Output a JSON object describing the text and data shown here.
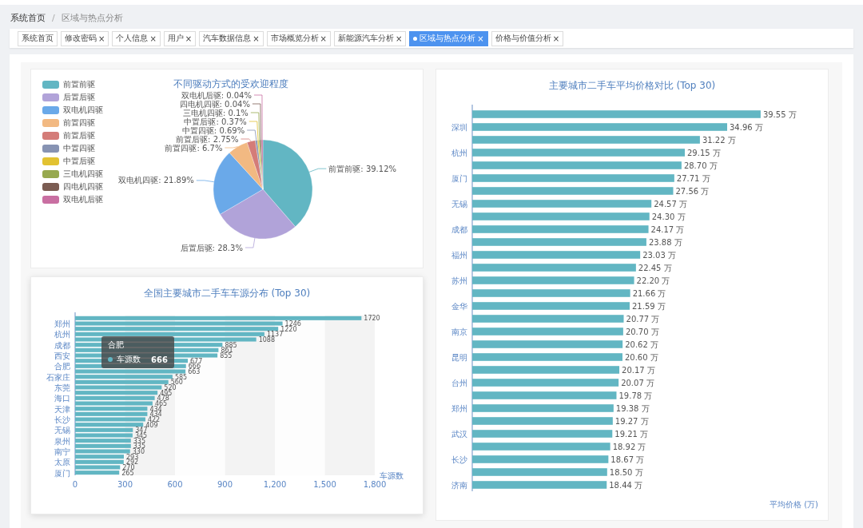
{
  "breadcrumb": {
    "items": [
      "系统首页",
      "区域与热点分析"
    ],
    "separator": "/"
  },
  "tabs": [
    {
      "label": "系统首页",
      "selected": false
    },
    {
      "label": "修改密码",
      "close": "×",
      "selected": false
    },
    {
      "label": "个人信息",
      "close": "×",
      "selected": false
    },
    {
      "label": "用户",
      "close": "×",
      "selected": false
    },
    {
      "label": "汽车数据信息",
      "close": "×",
      "selected": false
    },
    {
      "label": "市场概览分析",
      "close": "×",
      "selected": false
    },
    {
      "label": "新能源汽车分析",
      "close": "×",
      "selected": false
    },
    {
      "label": "区域与热点分析",
      "close": "×",
      "selected": true
    },
    {
      "label": "价格与价值分析",
      "close": "×",
      "selected": false
    }
  ],
  "drive_card": {
    "chart_data": {
      "type": "pie",
      "title": "不同驱动方式的受欢迎程度",
      "categories": [
        "前置前驱",
        "后置后驱",
        "双电机四驱",
        "前置四驱",
        "前置后驱",
        "中置四驱",
        "中置后驱",
        "三电机四驱",
        "四电机四驱",
        "双电机后驱"
      ],
      "values": [
        39.12,
        28.3,
        21.89,
        6.7,
        2.75,
        0.69,
        0.37,
        0.1,
        0.04,
        0.04
      ],
      "colors": [
        "#62b6c3",
        "#b1a3d9",
        "#6aa9e9",
        "#f2b982",
        "#d47c78",
        "#8793b3",
        "#e2c232",
        "#97a94f",
        "#7b5c52",
        "#c96fa2"
      ],
      "value_labels": [
        "前置前驱: 39.12%",
        "后置后驱: 28.3%",
        "双电机四驱: 21.89%",
        "前置四驱: 6.7%",
        "前置后驱: 2.75%",
        "中置四驱: 0.69%",
        "中置后驱: 0.37%",
        "三电机四驱: 0.1%",
        "四电机四驱: 0.04%",
        "双电机后驱: 0.04%"
      ]
    }
  },
  "city_card": {
    "chart_data": {
      "type": "bar",
      "orientation": "horizontal",
      "title": "全国主要城市二手车车源分布 (Top 30)",
      "xlabel": "车源数",
      "categories": [
        null,
        "郑州",
        null,
        "杭州",
        null,
        "成都",
        null,
        "西安",
        null,
        "合肥",
        null,
        "石家庄",
        null,
        "东莞",
        null,
        "海口",
        null,
        "天津",
        null,
        "长沙",
        null,
        "无锡",
        null,
        "泉州",
        null,
        "南宁",
        null,
        "太原",
        null,
        "厦门"
      ],
      "series": [
        {
          "name": "车源数",
          "color": "#62b6c3",
          "values": [
            1720,
            1246,
            1220,
            1137,
            1088,
            885,
            861,
            855,
            677,
            666,
            663,
            585,
            560,
            520,
            495,
            478,
            465,
            434,
            434,
            422,
            409,
            347,
            345,
            335,
            335,
            330,
            293,
            292,
            270,
            265
          ]
        }
      ],
      "xlim": [
        0,
        1800
      ],
      "xticks": [
        0,
        300,
        600,
        900,
        {
          "value": 1200,
          "label": "1,200"
        },
        {
          "value": 1500,
          "label": "1,500"
        },
        {
          "value": 1800,
          "label": "1,800"
        }
      ],
      "data_labels": true
    },
    "tooltip": {
      "title": "合肥",
      "value": "666"
    }
  },
  "price_card": {
    "chart_data": {
      "type": "bar",
      "orientation": "horizontal",
      "title": "主要城市二手车平均价格对比 (Top 30)",
      "xlabel": "平均价格 (万)",
      "categories": [
        null,
        "深圳",
        null,
        "杭州",
        null,
        "厦门",
        null,
        "无锡",
        null,
        "成都",
        null,
        "福州",
        null,
        "苏州",
        null,
        "金华",
        null,
        "南京",
        null,
        "昆明",
        null,
        "台州",
        null,
        "郑州",
        null,
        "武汉",
        null,
        "长沙",
        null,
        "济南"
      ],
      "values": [
        39.55,
        34.96,
        31.22,
        29.15,
        28.7,
        27.71,
        27.56,
        24.57,
        24.3,
        24.17,
        23.88,
        23.03,
        22.45,
        22.2,
        21.66,
        21.59,
        20.77,
        20.7,
        20.62,
        20.6,
        20.17,
        20.07,
        19.78,
        19.38,
        19.27,
        19.21,
        18.92,
        18.67,
        18.5,
        18.44
      ],
      "value_labels": [
        "39.55 万",
        "34.96 万",
        "31.22 万",
        "29.15 万",
        "28.70 万",
        "27.71 万",
        "27.56 万",
        "24.57 万",
        "24.30 万",
        "24.17 万",
        "23.88 万",
        "23.03 万",
        "22.45 万",
        "22.20 万",
        "21.66 万",
        "21.59 万",
        "20.77 万",
        "20.70 万",
        "20.62 万",
        "20.60 万",
        "20.17 万",
        "20.07 万",
        "19.78 万",
        "19.38 万",
        "19.27 万",
        "19.21 万",
        "18.92 万",
        "18.67 万",
        "18.50 万",
        "18.44 万"
      ]
    }
  }
}
